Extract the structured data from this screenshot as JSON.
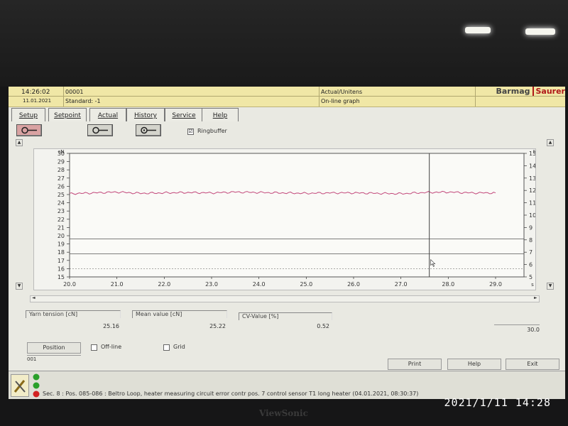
{
  "header": {
    "time": "14:26:02",
    "date": "11.01.2021",
    "code": "00001",
    "standard": "Standard: -1",
    "mode": "Actual/Unitens",
    "view": "On-line graph",
    "brand_main": "Barmag",
    "brand_second": "Saurer"
  },
  "tabs": [
    "Setup",
    "Setpoint",
    "Actual",
    "History",
    "Service",
    "Help"
  ],
  "toolbar": {
    "ringbuffer_label": "Ringbuffer",
    "ringbuffer_checked": "☑"
  },
  "chart_data": {
    "type": "line",
    "x": [
      20.0,
      20.5,
      21.0,
      21.5,
      22.0,
      22.5,
      23.0,
      23.5,
      24.0,
      24.5,
      25.0,
      25.5,
      26.0,
      26.5,
      27.0,
      27.5,
      28.0,
      28.5,
      29.0
    ],
    "series": [
      {
        "values": [
          25.1,
          25.2,
          25.3,
          25.15,
          25.2,
          25.25,
          25.2,
          25.3,
          25.25,
          25.2,
          25.15,
          25.2,
          25.2,
          25.15,
          25.1,
          25.25,
          25.3,
          25.2,
          25.2
        ]
      }
    ],
    "xlabel": "s",
    "ylabel": "cN",
    "y2label": "%",
    "xlim": [
      20.0,
      29.6
    ],
    "ylim": [
      15,
      30
    ],
    "y2lim": [
      5,
      15
    ],
    "x_ticks": [
      "20.0",
      "21.0",
      "22.0",
      "23.0",
      "24.0",
      "25.0",
      "26.0",
      "27.0",
      "28.0",
      "29.0"
    ],
    "y_ticks": [
      15,
      16,
      17,
      18,
      19,
      20,
      21,
      22,
      23,
      24,
      25,
      26,
      27,
      28,
      29,
      30
    ],
    "y2_ticks": [
      5,
      6,
      7,
      8,
      9,
      10,
      11,
      12,
      13,
      14,
      15
    ],
    "cursor_x": 27.6,
    "limit_lines": [
      17.8,
      19.6
    ],
    "dashed_lines": [
      16.0
    ],
    "series_color": "#c2477a"
  },
  "stats": {
    "yarn_label": "Yarn tension [cN]",
    "yarn_value": "25.16",
    "mean_label": "Mean value [cN]",
    "mean_value": "25.22",
    "cv_label": "CV-Value [%]",
    "cv_value": "0.52",
    "range_value": "30.0"
  },
  "bottom": {
    "position_label": "Position",
    "position_value": "001",
    "offline_label": "Off-line",
    "grid_label": "Grid",
    "print_label": "Print",
    "help_label": "Help",
    "exit_label": "Exit"
  },
  "status": {
    "message": "Sec. 8 : Pos. 085-086 : Beltro Loop, heater measuring circuit error contr pos. 7 control sensor T1 long heater (04.01.2021, 08:30:37)"
  },
  "photo": {
    "timestamp": "2021/1/11  14:28",
    "monitor_brand": "ViewSonic"
  },
  "colors": {
    "header_bg": "#f0e7a6",
    "series": "#c2477a",
    "error": "#d22222",
    "ok": "#22a022"
  }
}
